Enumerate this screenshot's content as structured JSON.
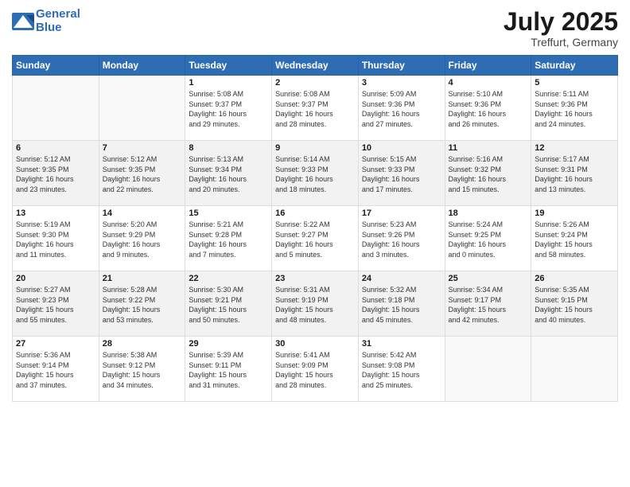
{
  "logo": {
    "line1": "General",
    "line2": "Blue"
  },
  "title": {
    "month_year": "July 2025",
    "location": "Treffurt, Germany"
  },
  "days_of_week": [
    "Sunday",
    "Monday",
    "Tuesday",
    "Wednesday",
    "Thursday",
    "Friday",
    "Saturday"
  ],
  "weeks": [
    [
      {
        "day": "",
        "info": ""
      },
      {
        "day": "",
        "info": ""
      },
      {
        "day": "1",
        "info": "Sunrise: 5:08 AM\nSunset: 9:37 PM\nDaylight: 16 hours\nand 29 minutes."
      },
      {
        "day": "2",
        "info": "Sunrise: 5:08 AM\nSunset: 9:37 PM\nDaylight: 16 hours\nand 28 minutes."
      },
      {
        "day": "3",
        "info": "Sunrise: 5:09 AM\nSunset: 9:36 PM\nDaylight: 16 hours\nand 27 minutes."
      },
      {
        "day": "4",
        "info": "Sunrise: 5:10 AM\nSunset: 9:36 PM\nDaylight: 16 hours\nand 26 minutes."
      },
      {
        "day": "5",
        "info": "Sunrise: 5:11 AM\nSunset: 9:36 PM\nDaylight: 16 hours\nand 24 minutes."
      }
    ],
    [
      {
        "day": "6",
        "info": "Sunrise: 5:12 AM\nSunset: 9:35 PM\nDaylight: 16 hours\nand 23 minutes."
      },
      {
        "day": "7",
        "info": "Sunrise: 5:12 AM\nSunset: 9:35 PM\nDaylight: 16 hours\nand 22 minutes."
      },
      {
        "day": "8",
        "info": "Sunrise: 5:13 AM\nSunset: 9:34 PM\nDaylight: 16 hours\nand 20 minutes."
      },
      {
        "day": "9",
        "info": "Sunrise: 5:14 AM\nSunset: 9:33 PM\nDaylight: 16 hours\nand 18 minutes."
      },
      {
        "day": "10",
        "info": "Sunrise: 5:15 AM\nSunset: 9:33 PM\nDaylight: 16 hours\nand 17 minutes."
      },
      {
        "day": "11",
        "info": "Sunrise: 5:16 AM\nSunset: 9:32 PM\nDaylight: 16 hours\nand 15 minutes."
      },
      {
        "day": "12",
        "info": "Sunrise: 5:17 AM\nSunset: 9:31 PM\nDaylight: 16 hours\nand 13 minutes."
      }
    ],
    [
      {
        "day": "13",
        "info": "Sunrise: 5:19 AM\nSunset: 9:30 PM\nDaylight: 16 hours\nand 11 minutes."
      },
      {
        "day": "14",
        "info": "Sunrise: 5:20 AM\nSunset: 9:29 PM\nDaylight: 16 hours\nand 9 minutes."
      },
      {
        "day": "15",
        "info": "Sunrise: 5:21 AM\nSunset: 9:28 PM\nDaylight: 16 hours\nand 7 minutes."
      },
      {
        "day": "16",
        "info": "Sunrise: 5:22 AM\nSunset: 9:27 PM\nDaylight: 16 hours\nand 5 minutes."
      },
      {
        "day": "17",
        "info": "Sunrise: 5:23 AM\nSunset: 9:26 PM\nDaylight: 16 hours\nand 3 minutes."
      },
      {
        "day": "18",
        "info": "Sunrise: 5:24 AM\nSunset: 9:25 PM\nDaylight: 16 hours\nand 0 minutes."
      },
      {
        "day": "19",
        "info": "Sunrise: 5:26 AM\nSunset: 9:24 PM\nDaylight: 15 hours\nand 58 minutes."
      }
    ],
    [
      {
        "day": "20",
        "info": "Sunrise: 5:27 AM\nSunset: 9:23 PM\nDaylight: 15 hours\nand 55 minutes."
      },
      {
        "day": "21",
        "info": "Sunrise: 5:28 AM\nSunset: 9:22 PM\nDaylight: 15 hours\nand 53 minutes."
      },
      {
        "day": "22",
        "info": "Sunrise: 5:30 AM\nSunset: 9:21 PM\nDaylight: 15 hours\nand 50 minutes."
      },
      {
        "day": "23",
        "info": "Sunrise: 5:31 AM\nSunset: 9:19 PM\nDaylight: 15 hours\nand 48 minutes."
      },
      {
        "day": "24",
        "info": "Sunrise: 5:32 AM\nSunset: 9:18 PM\nDaylight: 15 hours\nand 45 minutes."
      },
      {
        "day": "25",
        "info": "Sunrise: 5:34 AM\nSunset: 9:17 PM\nDaylight: 15 hours\nand 42 minutes."
      },
      {
        "day": "26",
        "info": "Sunrise: 5:35 AM\nSunset: 9:15 PM\nDaylight: 15 hours\nand 40 minutes."
      }
    ],
    [
      {
        "day": "27",
        "info": "Sunrise: 5:36 AM\nSunset: 9:14 PM\nDaylight: 15 hours\nand 37 minutes."
      },
      {
        "day": "28",
        "info": "Sunrise: 5:38 AM\nSunset: 9:12 PM\nDaylight: 15 hours\nand 34 minutes."
      },
      {
        "day": "29",
        "info": "Sunrise: 5:39 AM\nSunset: 9:11 PM\nDaylight: 15 hours\nand 31 minutes."
      },
      {
        "day": "30",
        "info": "Sunrise: 5:41 AM\nSunset: 9:09 PM\nDaylight: 15 hours\nand 28 minutes."
      },
      {
        "day": "31",
        "info": "Sunrise: 5:42 AM\nSunset: 9:08 PM\nDaylight: 15 hours\nand 25 minutes."
      },
      {
        "day": "",
        "info": ""
      },
      {
        "day": "",
        "info": ""
      }
    ]
  ]
}
